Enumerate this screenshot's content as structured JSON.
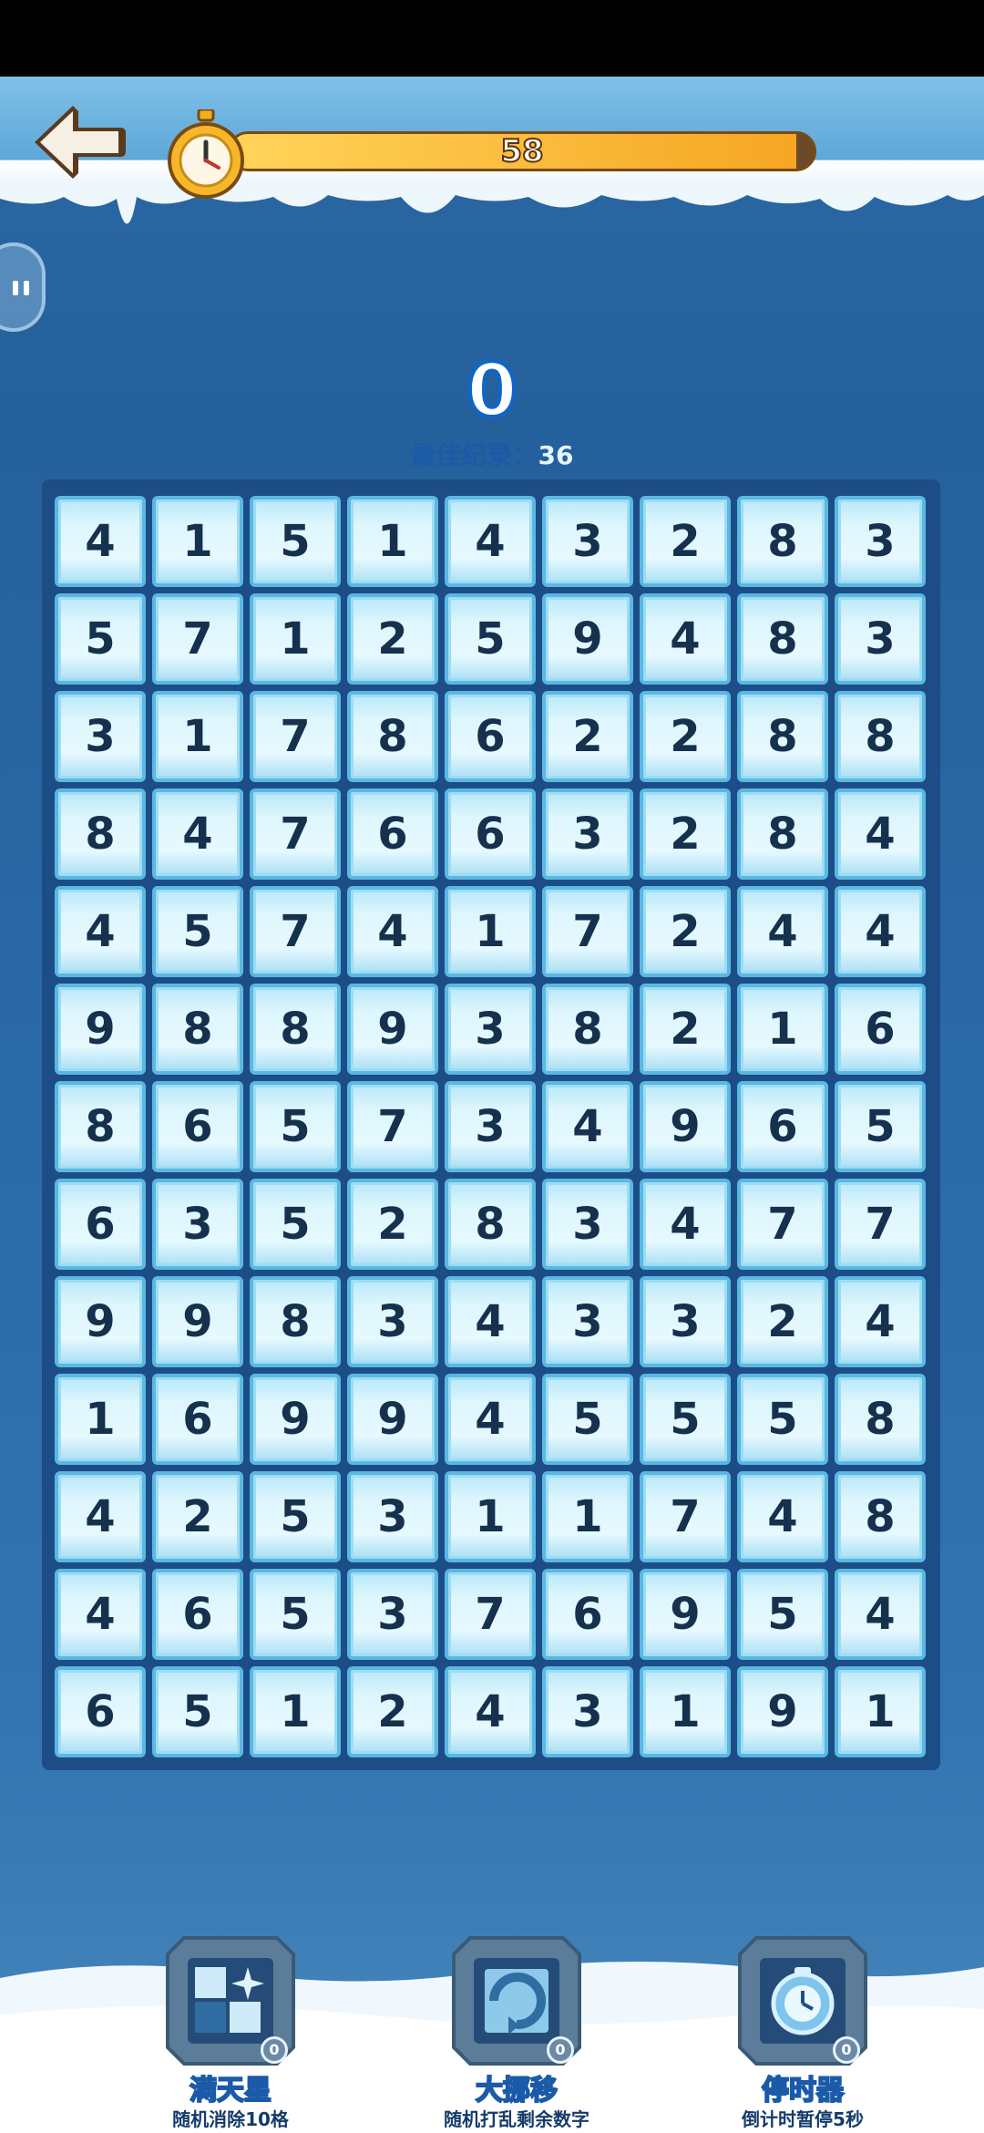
{
  "timer": {
    "value": "58",
    "progress": 0.97
  },
  "score": {
    "value": "0",
    "best_label": "最佳纪录：",
    "best_value": "36"
  },
  "grid": [
    [
      4,
      1,
      5,
      1,
      4,
      3,
      2,
      8,
      3
    ],
    [
      5,
      7,
      1,
      2,
      5,
      9,
      4,
      8,
      3
    ],
    [
      3,
      1,
      7,
      8,
      6,
      2,
      2,
      8,
      8
    ],
    [
      8,
      4,
      7,
      6,
      6,
      3,
      2,
      8,
      4
    ],
    [
      4,
      5,
      7,
      4,
      1,
      7,
      2,
      4,
      4
    ],
    [
      9,
      8,
      8,
      9,
      3,
      8,
      2,
      1,
      6
    ],
    [
      8,
      6,
      5,
      7,
      3,
      4,
      9,
      6,
      5
    ],
    [
      6,
      3,
      5,
      2,
      8,
      3,
      4,
      7,
      7
    ],
    [
      9,
      9,
      8,
      3,
      4,
      3,
      3,
      2,
      4
    ],
    [
      1,
      6,
      9,
      9,
      4,
      5,
      5,
      5,
      8
    ],
    [
      4,
      2,
      5,
      3,
      1,
      1,
      7,
      4,
      8
    ],
    [
      4,
      6,
      5,
      3,
      7,
      6,
      9,
      5,
      4
    ],
    [
      6,
      5,
      1,
      2,
      4,
      3,
      1,
      9,
      1
    ]
  ],
  "powerups": [
    {
      "name": "满天星",
      "desc": "随机消除10格",
      "count": "0",
      "icon": "stars-icon"
    },
    {
      "name": "大挪移",
      "desc": "随机打乱剩余数字",
      "count": "0",
      "icon": "shuffle-icon"
    },
    {
      "name": "停时器",
      "desc": "倒计时暂停5秒",
      "count": "0",
      "icon": "frozen-clock-icon"
    }
  ],
  "colors": {
    "tile_text": "#15314d",
    "board": "#1d4d86",
    "timer_fill": "#f6a623"
  }
}
